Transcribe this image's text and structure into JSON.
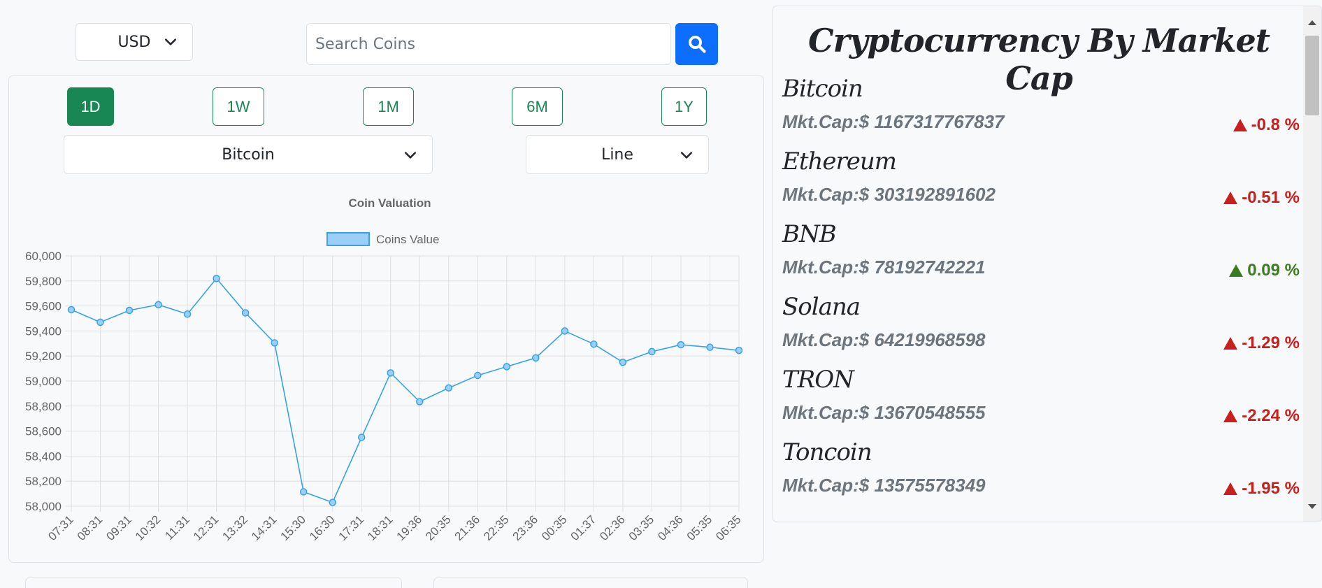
{
  "currency": {
    "selected": "USD"
  },
  "search": {
    "placeholder": "Search Coins"
  },
  "timeframes": [
    {
      "label": "1D",
      "active": true
    },
    {
      "label": "1W",
      "active": false
    },
    {
      "label": "1M",
      "active": false
    },
    {
      "label": "6M",
      "active": false
    },
    {
      "label": "1Y",
      "active": false
    }
  ],
  "coin_select": {
    "selected": "Bitcoin"
  },
  "chart_type_select": {
    "selected": "Line"
  },
  "chart_data": {
    "type": "line",
    "title": "Coin Valuation",
    "series": [
      {
        "name": "Coins Value",
        "values": [
          59570,
          59470,
          59565,
          59610,
          59535,
          59820,
          59545,
          59305,
          58115,
          58030,
          58550,
          59065,
          58835,
          58945,
          59045,
          59115,
          59185,
          59400,
          59295,
          59150,
          59235,
          59290,
          59270,
          59245
        ]
      }
    ],
    "categories": [
      "07:31",
      "08:31",
      "09:31",
      "10:32",
      "11:31",
      "12:31",
      "13:32",
      "14:31",
      "15:30",
      "16:30",
      "17:31",
      "18:31",
      "19:36",
      "20:35",
      "21:36",
      "22:35",
      "23:36",
      "00:35",
      "01:37",
      "02:36",
      "03:35",
      "04:36",
      "05:35",
      "06:35"
    ],
    "yticks": [
      "60,000",
      "59,800",
      "59,600",
      "59,400",
      "59,200",
      "59,000",
      "58,800",
      "58,600",
      "58,400",
      "58,200",
      "58,000"
    ],
    "ylim": [
      58000,
      60000
    ],
    "xlabel": "",
    "ylabel": "",
    "legend": "top",
    "grid": true,
    "line_color": "#36a2eb",
    "fill_color": "#9ad0f5"
  },
  "market_cap": {
    "title": "Cryptocurrency By Market Cap",
    "coins": [
      {
        "name": "Bitcoin",
        "cap": "Mkt.Cap:$ 1167317767837",
        "change": "-0.8 %",
        "color": "#c81e1e"
      },
      {
        "name": "Ethereum",
        "cap": "Mkt.Cap:$ 303192891602",
        "change": "-0.51 %",
        "color": "#c81e1e"
      },
      {
        "name": "BNB",
        "cap": "Mkt.Cap:$ 78192742221",
        "change": "0.09 %",
        "color": "#3a7d1e"
      },
      {
        "name": "Solana",
        "cap": "Mkt.Cap:$ 64219968598",
        "change": "-1.29 %",
        "color": "#c81e1e"
      },
      {
        "name": "TRON",
        "cap": "Mkt.Cap:$ 13670548555",
        "change": "-2.24 %",
        "color": "#c81e1e"
      },
      {
        "name": "Toncoin",
        "cap": "Mkt.Cap:$ 13575578349",
        "change": "-1.95 %",
        "color": "#c81e1e"
      }
    ]
  }
}
